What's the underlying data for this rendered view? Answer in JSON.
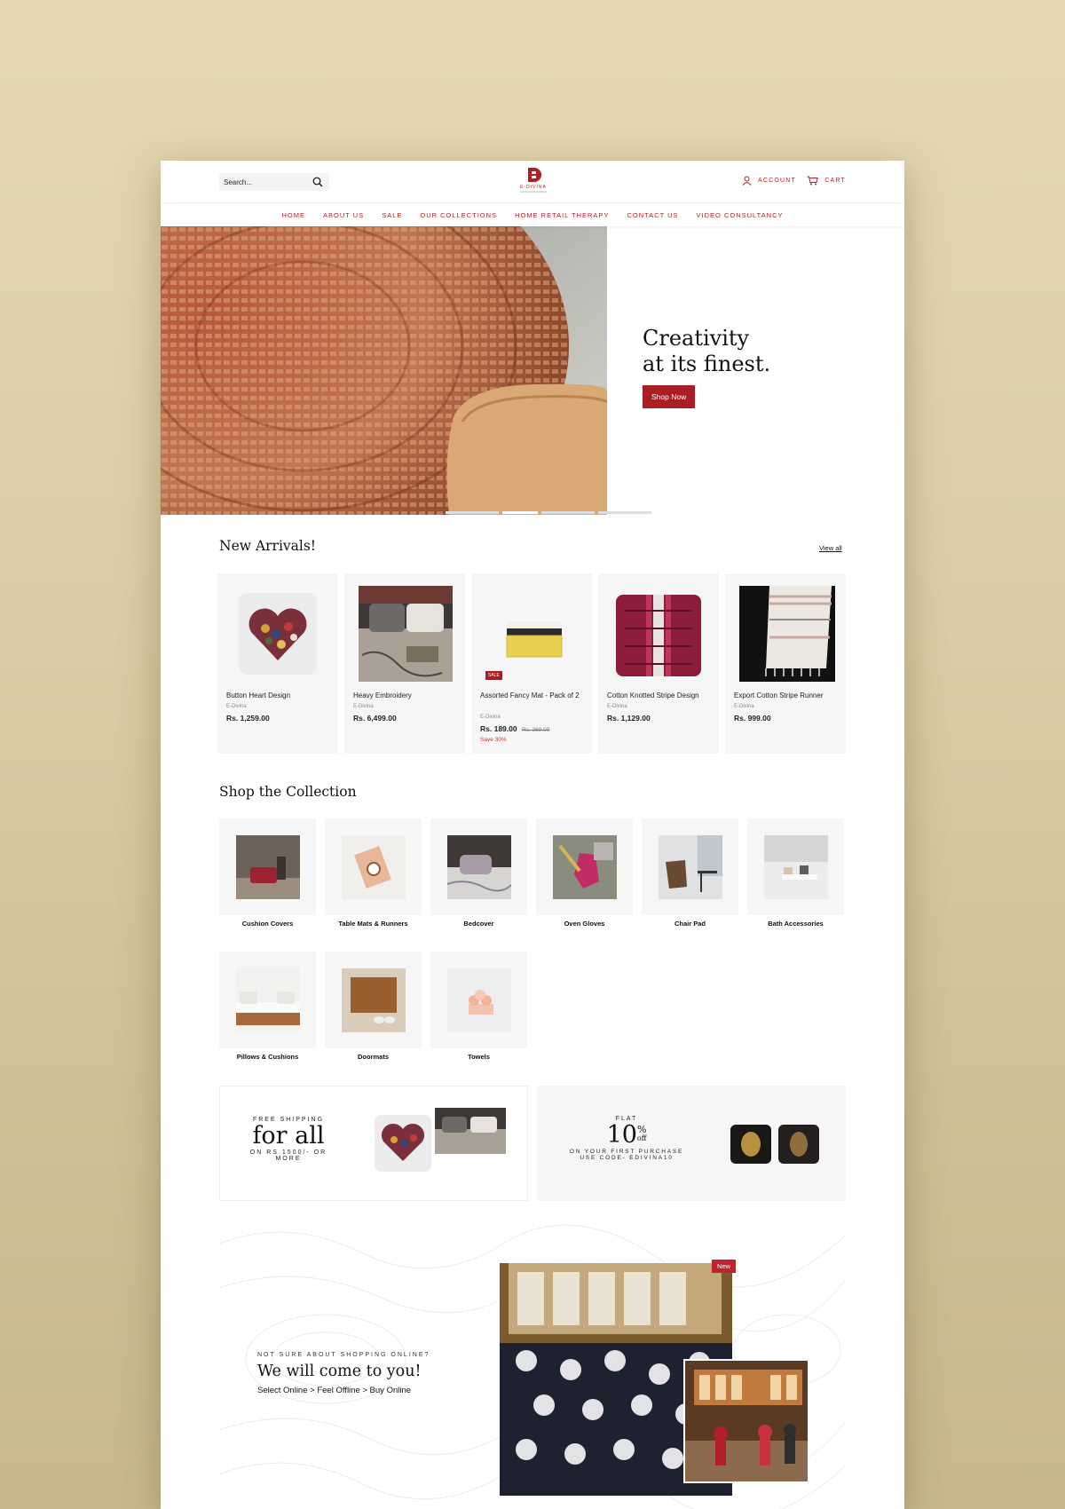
{
  "header": {
    "search_placeholder": "Search...",
    "logo_word": "E-DIVINA",
    "logo_tagline": "HOME FURNISHINGS",
    "account_label": "ACCOUNT",
    "cart_label": "CART"
  },
  "nav": [
    "HOME",
    "ABOUT US",
    "SALE",
    "OUR COLLECTIONS",
    "HOME RETAIL THERAPY",
    "CONTACT US",
    "VIDEO CONSULTANCY"
  ],
  "hero": {
    "line1": "Creativity",
    "line2": "at its finest.",
    "cta": "Shop Now"
  },
  "new_arrivals": {
    "title": "New Arrivals!",
    "view_all": "View all",
    "products": [
      {
        "name": "Button Heart Design",
        "brand": "E-Divina",
        "price": "Rs. 1,259.00"
      },
      {
        "name": "Heavy Embroidery",
        "brand": "E-Divina",
        "price": "Rs. 6,499.00"
      },
      {
        "name": "Assorted Fancy Mat - Pack of 2",
        "brand": "E-Divina",
        "price": "Rs. 189.00",
        "old_price": "Rs. 269.00",
        "save": "Save 30%",
        "badge": "SALE"
      },
      {
        "name": "Cotton Knotted Stripe Design",
        "brand": "E-Divina",
        "price": "Rs. 1,129.00"
      },
      {
        "name": "Export Cotton Stripe Runner",
        "brand": "E-Divina",
        "price": "Rs. 999.00"
      }
    ]
  },
  "collection": {
    "title": "Shop the Collection",
    "items": [
      "Cushion Covers",
      "Table Mats & Runners",
      "Bedcover",
      "Oven Gloves",
      "Chair Pad",
      "Bath Accessories",
      "Pillows & Cushions",
      "Doormats",
      "Towels"
    ]
  },
  "promo_shipping": {
    "small_top": "FREE SHIPPING",
    "big": "for all",
    "small_bottom": "ON RS.1500/- OR MORE"
  },
  "promo_discount": {
    "small_top": "FLAT",
    "big": "10",
    "percent": "%",
    "off": "off",
    "small_bottom": "ON YOUR FIRST PURCHASE USE CODE- EDIVINA10"
  },
  "visit": {
    "small": "NOT SURE ABOUT SHOPPING ONLINE?",
    "title": "We will come to you!",
    "sub": "Select Online > Feel Offline > Buy Online",
    "badge": "New"
  },
  "colors": {
    "brand": "#a91e23",
    "card_bg": "#f6f6f6"
  }
}
